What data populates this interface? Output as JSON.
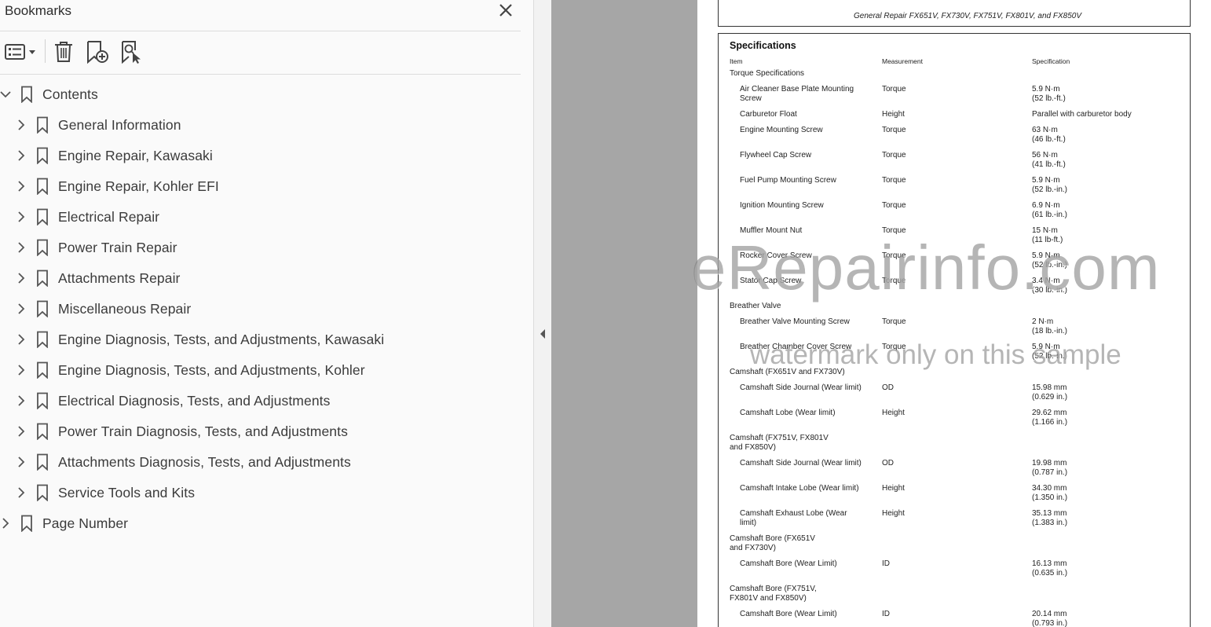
{
  "panel": {
    "title": "Bookmarks",
    "tools": {
      "options": "options-menu-icon",
      "delete": "trash-icon",
      "add": "add-bookmark-icon",
      "find": "find-bookmark-icon"
    },
    "items": [
      {
        "label": "Contents",
        "expanded": true
      },
      {
        "label": "General Information"
      },
      {
        "label": "Engine Repair, Kawasaki"
      },
      {
        "label": "Engine Repair, Kohler EFI"
      },
      {
        "label": "Electrical Repair"
      },
      {
        "label": "Power Train Repair"
      },
      {
        "label": "Attachments Repair"
      },
      {
        "label": "Miscellaneous Repair"
      },
      {
        "label": "Engine Diagnosis, Tests, and Adjustments, Kawasaki"
      },
      {
        "label": "Engine Diagnosis, Tests, and Adjustments, Kohler"
      },
      {
        "label": "Electrical Diagnosis, Tests, and Adjustments"
      },
      {
        "label": "Power Train Diagnosis, Tests, and Adjustments"
      },
      {
        "label": "Attachments Diagnosis, Tests, and Adjustments"
      },
      {
        "label": "Service Tools and Kits"
      },
      {
        "label": "Page Number",
        "expanded": false
      }
    ]
  },
  "document": {
    "header": "General Repair FX651V, FX730V, FX751V, FX801V, and FX850V",
    "title": "Specifications",
    "columns": [
      "Item",
      "Measurement",
      "Specification"
    ],
    "rows": [
      {
        "kind": "section",
        "item": [
          "Torque Specifications"
        ]
      },
      {
        "item": [
          "Air Cleaner Base Plate Mounting",
          "Screw"
        ],
        "measurement": "Torque",
        "spec": [
          "5.9 N·m",
          "(52 lb.-ft.)"
        ]
      },
      {
        "item": [
          "Carburetor Float"
        ],
        "measurement": "Height",
        "spec": [
          "Parallel with carburetor body"
        ]
      },
      {
        "item": [
          "Engine Mounting Screw"
        ],
        "measurement": "Torque",
        "spec": [
          "63 N·m",
          "(46 lb.-ft.)"
        ]
      },
      {
        "item": [
          "Flywheel Cap Screw"
        ],
        "measurement": "Torque",
        "spec": [
          "56 N·m",
          "(41 lb.-ft.)"
        ]
      },
      {
        "item": [
          "Fuel Pump Mounting Screw"
        ],
        "measurement": "Torque",
        "spec": [
          "5.9 N·m",
          "(52 lb.-in.)"
        ]
      },
      {
        "item": [
          "Ignition Mounting Screw"
        ],
        "measurement": "Torque",
        "spec": [
          "6.9 N·m",
          "(61 lb.-in.)"
        ]
      },
      {
        "item": [
          "Muffler Mount Nut"
        ],
        "measurement": "Torque",
        "spec": [
          "15 N·m",
          "(11 lb-ft.)"
        ]
      },
      {
        "item": [
          "Rocker Cover Screw"
        ],
        "measurement": "Torque",
        "spec": [
          "5.9 N·m",
          "(52 lb.-in.)"
        ]
      },
      {
        "item": [
          "Stator Cap Screw"
        ],
        "measurement": "Torque",
        "spec": [
          "3.4 N·m",
          "(30 lb.-in.)"
        ]
      },
      {
        "kind": "section",
        "item": [
          "Breather Valve"
        ]
      },
      {
        "item": [
          "Breather Valve Mounting Screw"
        ],
        "measurement": "Torque",
        "spec": [
          "2 N·m",
          "(18 lb.-in.)"
        ]
      },
      {
        "item": [
          "Breather Chamber Cover Screw"
        ],
        "measurement": "Torque",
        "spec": [
          "5.9 N·m",
          "(52 lb.-in.)"
        ]
      },
      {
        "kind": "section",
        "item": [
          "Camshaft (FX651V and FX730V)"
        ]
      },
      {
        "item": [
          "Camshaft Side Journal (Wear limit)"
        ],
        "measurement": "OD",
        "spec": [
          "15.98 mm",
          "(0.629 in.)"
        ]
      },
      {
        "item": [
          "Camshaft Lobe (Wear limit)"
        ],
        "measurement": "Height",
        "spec": [
          "29.62 mm",
          "(1.166 in.)"
        ]
      },
      {
        "kind": "section",
        "item": [
          "Camshaft (FX751V, FX801V",
          " and FX850V)"
        ]
      },
      {
        "item": [
          "Camshaft Side Journal (Wear limit)"
        ],
        "measurement": "OD",
        "spec": [
          "19.98 mm",
          "(0.787 in.)"
        ]
      },
      {
        "item": [
          "Camshaft Intake Lobe (Wear limit)"
        ],
        "measurement": "Height",
        "spec": [
          "34.30 mm",
          "(1.350 in.)"
        ]
      },
      {
        "item": [
          "Camshaft Exhaust Lobe (Wear",
          "limit)"
        ],
        "measurement": "Height",
        "spec": [
          "35.13 mm",
          "(1.383 in.)"
        ]
      },
      {
        "kind": "section",
        "item": [
          "Camshaft Bore (FX651V",
          " and FX730V)"
        ]
      },
      {
        "item": [
          "Camshaft Bore (Wear Limit)"
        ],
        "measurement": "ID",
        "spec": [
          "16.13 mm",
          "(0.635 in.)"
        ]
      },
      {
        "kind": "section",
        "item": [
          "Camshaft Bore (FX751V,",
          " FX801V and FX850V)"
        ]
      },
      {
        "item": [
          "Camshaft Bore (Wear Limit)"
        ],
        "measurement": "ID",
        "spec": [
          "20.14 mm",
          "(0.793 in.)"
        ]
      }
    ]
  },
  "watermark": {
    "line1": "eRepairinfo.com",
    "line2": "watermark only on this sample"
  }
}
